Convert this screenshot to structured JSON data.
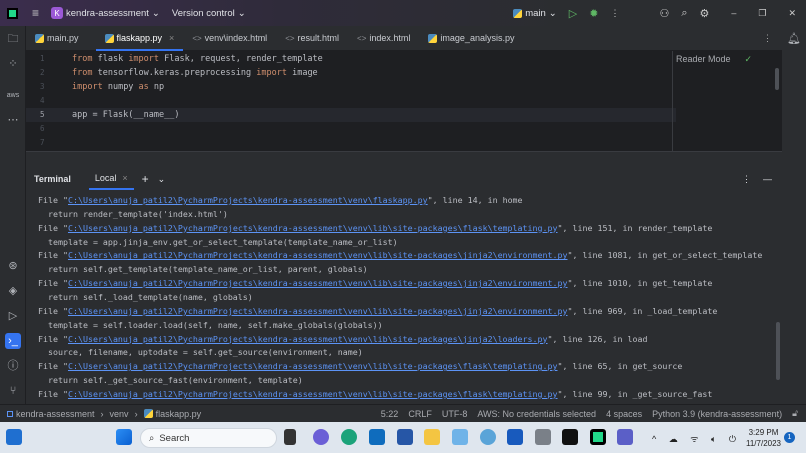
{
  "titlebar": {
    "project_initial": "K",
    "project": "kendra-assessment",
    "vcs": "Version control",
    "branch": "main"
  },
  "tabs": [
    {
      "label": "main.py",
      "type": "py"
    },
    {
      "label": "flaskapp.py",
      "type": "py",
      "active": true
    },
    {
      "label": "venv\\index.html",
      "type": "html"
    },
    {
      "label": "result.html",
      "type": "html"
    },
    {
      "label": "index.html",
      "type": "html"
    },
    {
      "label": "image_analysis.py",
      "type": "py"
    }
  ],
  "editor": {
    "reader_mode": "Reader Mode",
    "current_line": 5,
    "lines": [
      [
        [
          "kw",
          "from"
        ],
        [
          "tx",
          " flask "
        ],
        [
          "kw",
          "import"
        ],
        [
          "tx",
          " Flask, request, render_template"
        ]
      ],
      [
        [
          "kw",
          "from"
        ],
        [
          "tx",
          " tensorflow.keras.preprocessing "
        ],
        [
          "kw",
          "import"
        ],
        [
          "tx",
          " image"
        ]
      ],
      [
        [
          "kw",
          "import"
        ],
        [
          "tx",
          " numpy "
        ],
        [
          "kw",
          "as"
        ],
        [
          "tx",
          " np"
        ]
      ],
      [],
      [
        [
          "tx",
          "app = Flask(__name__)"
        ]
      ],
      [],
      []
    ]
  },
  "terminal": {
    "title": "Terminal",
    "tab": "Local",
    "lines": [
      {
        "pre": "File \"",
        "link": "C:\\Users\\anuja_patil2\\PycharmProjects\\kendra-assessment\\venv\\flaskapp.py",
        "post": "\", line 14, in home"
      },
      {
        "text": "  return render_template('index.html')"
      },
      {
        "pre": "File \"",
        "link": "C:\\Users\\anuja_patil2\\PycharmProjects\\kendra-assessment\\venv\\lib\\site-packages\\flask\\templating.py",
        "post": "\", line 151, in render_template"
      },
      {
        "text": "  template = app.jinja_env.get_or_select_template(template_name_or_list)"
      },
      {
        "pre": "File \"",
        "link": "C:\\Users\\anuja_patil2\\PycharmProjects\\kendra-assessment\\venv\\lib\\site-packages\\jinja2\\environment.py",
        "post": "\", line 1081, in get_or_select_template"
      },
      {
        "text": "  return self.get_template(template_name_or_list, parent, globals)"
      },
      {
        "pre": "File \"",
        "link": "C:\\Users\\anuja_patil2\\PycharmProjects\\kendra-assessment\\venv\\lib\\site-packages\\jinja2\\environment.py",
        "post": "\", line 1010, in get_template"
      },
      {
        "text": "  return self._load_template(name, globals)"
      },
      {
        "pre": "File \"",
        "link": "C:\\Users\\anuja_patil2\\PycharmProjects\\kendra-assessment\\venv\\lib\\site-packages\\jinja2\\environment.py",
        "post": "\", line 969, in _load_template"
      },
      {
        "text": "  template = self.loader.load(self, name, self.make_globals(globals))"
      },
      {
        "pre": "File \"",
        "link": "C:\\Users\\anuja_patil2\\PycharmProjects\\kendra-assessment\\venv\\lib\\site-packages\\jinja2\\loaders.py",
        "post": "\", line 126, in load"
      },
      {
        "text": "  source, filename, uptodate = self.get_source(environment, name)"
      },
      {
        "pre": "File \"",
        "link": "C:\\Users\\anuja_patil2\\PycharmProjects\\kendra-assessment\\venv\\lib\\site-packages\\flask\\templating.py",
        "post": "\", line 65, in get_source"
      },
      {
        "text": "  return self._get_source_fast(environment, template)"
      },
      {
        "pre": "File \"",
        "link": "C:\\Users\\anuja_patil2\\PycharmProjects\\kendra-assessment\\venv\\lib\\site-packages\\flask\\templating.py",
        "post": "\", line 99, in _get_source_fast"
      }
    ]
  },
  "statusbar": {
    "crumbs": [
      "kendra-assessment",
      "venv",
      "flaskapp.py"
    ],
    "position": "5:22",
    "line_sep": "CRLF",
    "encoding": "UTF-8",
    "aws": "AWS: No credentials selected",
    "indent": "4 spaces",
    "interpreter": "Python 3.9 (kendra-assessment)"
  },
  "taskbar": {
    "search": "Search",
    "time": "3:29 PM",
    "date": "11/7/2023",
    "notifications": "1"
  }
}
